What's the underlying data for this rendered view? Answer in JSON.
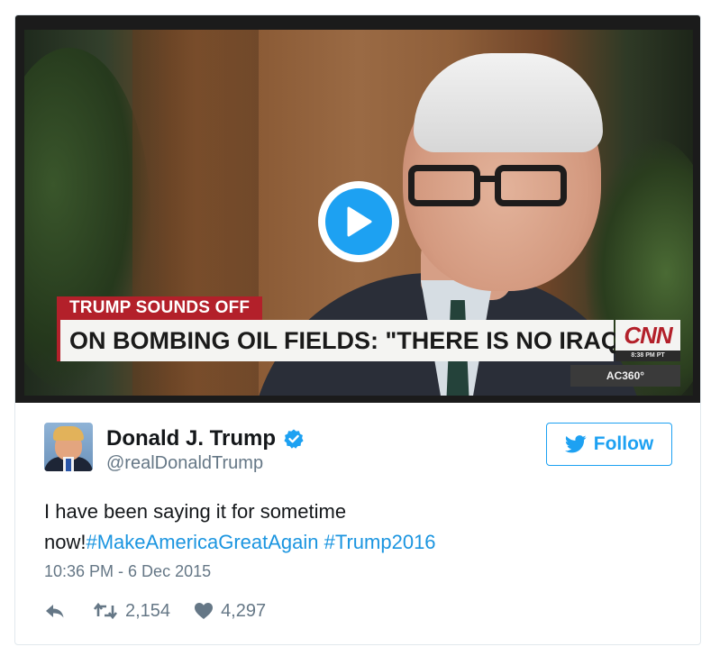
{
  "video": {
    "lower_third_label": "TRUMP SOUNDS OFF",
    "headline": "ON BOMBING OIL FIELDS: \"THERE IS NO IRAQ\"",
    "network_logo": "CNN",
    "time": "8:38 PM PT",
    "show": "AC360°",
    "play_icon": "play-icon"
  },
  "tweet": {
    "display_name": "Donald J. Trump",
    "verified_icon": "verified-badge-icon",
    "handle": "@realDonaldTrump",
    "follow_label": "Follow",
    "text_plain": "I have been saying it for sometime now!",
    "hashtags": [
      "#MakeAmericaGreatAgain",
      "#Trump2016"
    ],
    "timestamp": "10:36 PM - 6 Dec 2015",
    "retweets": "2,154",
    "likes": "4,297"
  },
  "colors": {
    "accent": "#1da1f2",
    "hashtag": "#1b95e0",
    "muted": "#657786",
    "cnn_red": "#b3202a"
  }
}
